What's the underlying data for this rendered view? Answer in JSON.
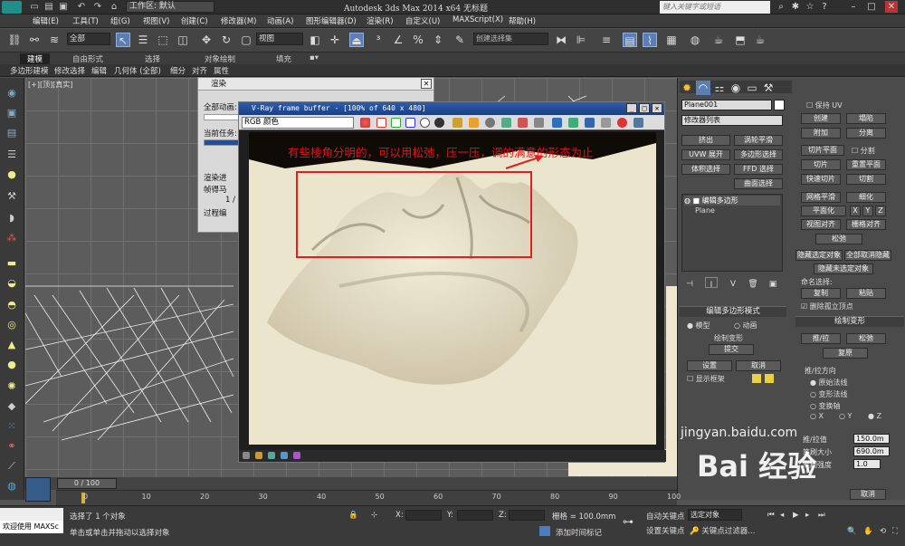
{
  "titlebar": {
    "workspace_label": "工作区: 默认",
    "app_title": "Autodesk 3ds Max  2014 x64       无标题",
    "search_placeholder": "键入关键字或短语"
  },
  "menu": [
    "编辑(E)",
    "工具(T)",
    "组(G)",
    "视图(V)",
    "创建(C)",
    "修改器(M)",
    "动画(A)",
    "图形编辑器(D)",
    "渲染(R)",
    "自定义(U)",
    "MAXScript(X)",
    "帮助(H)"
  ],
  "toolbar": {
    "selection_filter": "全部",
    "ref_coord": "视图",
    "named_selection": "创建选择集"
  },
  "ribbon": {
    "tabs": [
      "建模",
      "自由形式",
      "选择",
      "对象绘制",
      "填充"
    ],
    "subtabs": [
      "多边形建模",
      "修改选择",
      "编辑",
      "几何体 (全部)",
      "细分",
      "对齐",
      "属性"
    ]
  },
  "viewport": {
    "label": "[+][顶][真实]"
  },
  "render_dialog": {
    "title": "渲染",
    "all_anim": "全部动画:",
    "current_task": "当前任务:",
    "rows": [
      "渲染进",
      "帧得马",
      "1 /",
      "过程编"
    ]
  },
  "vfb": {
    "title": "V-Ray frame buffer - [100% of 640 x 480]",
    "channel": "RGB 颜色"
  },
  "annotation": "有些棱角分明的，可以用松弛，压一压，调的满意的形态为止",
  "command_panel": {
    "object_name": "Plane001",
    "modifier_list": "修改器列表",
    "buttons_left": [
      {
        "a": "挤出",
        "b": "涡轮平滑"
      },
      {
        "a": "UVW 展开",
        "b": "多边形选择"
      },
      {
        "a": "体积选择",
        "b": "FFD 选择"
      },
      {
        "a": "",
        "b": "曲面选择"
      }
    ],
    "stack": [
      "编辑多边形",
      "Plane"
    ],
    "paint_deform": {
      "header": "编辑多边形模式",
      "model": "模型",
      "anim": "动画",
      "label": "绘制变形",
      "commit": "提交",
      "settings": "设置",
      "cancel": "取消",
      "show_cage": "显示框架"
    },
    "right_col": {
      "keep_uv": "保持 UV",
      "create": "创建",
      "collapse": "塌陷",
      "attach": "附加",
      "detach": "分离",
      "slice_plane": "切片平面",
      "split": "分割",
      "slice": "切片",
      "reset_plane": "重置平面",
      "quickslice": "快速切片",
      "cut": "切割",
      "meshsmooth": "网格平滑",
      "tessellate": "细化",
      "planarize": "平面化",
      "x": "X",
      "y": "Y",
      "z": "Z",
      "view_align": "视图对齐",
      "grid_align": "栅格对齐",
      "relax": "松弛",
      "hide_sel": "隐藏选定对象",
      "unhide_all": "全部取消隐藏",
      "hide_unsel": "隐藏未选定对象",
      "named_sel": "命名选择:",
      "copy": "复制",
      "paste": "粘贴",
      "delete_iso": "删除孤立顶点",
      "paint_deform_hdr": "绘制变形",
      "push_pull": "推/拉",
      "relax2": "松弛",
      "revert": "复原",
      "pp_dir": "推/拉方向",
      "orig_normals": "原始法线",
      "deformed_normals": "变形法线",
      "transform_axis": "变换轴",
      "ax": "X",
      "ay": "Y",
      "az": "Z",
      "pp_value": "推/拉值",
      "pp_val_num": "150.0m",
      "brush_size": "笔刷大小",
      "brush_size_num": "690.0m",
      "brush_strength": "笔刷强度",
      "brush_strength_num": "1.0",
      "cancel": "取消"
    }
  },
  "timeline": {
    "frame": "0 / 100",
    "ticks": [
      "0",
      "10",
      "20",
      "30",
      "40",
      "50",
      "60",
      "70",
      "80",
      "90",
      "100"
    ]
  },
  "status": {
    "selected": "选择了 1 个对象",
    "hint": "单击或单击并拖动以选择对象",
    "maxscript": "欢迎使用 MAXSc",
    "x_label": "X:",
    "y_label": "Y:",
    "z_label": "Z:",
    "grid": "栅格 = 100.0mm",
    "auto_key": "自动关键点",
    "set_key": "设置关键点",
    "sel_obj": "选定对象",
    "add_time": "添加时间标记",
    "key_filter": "关键点过滤器..."
  },
  "watermark": {
    "logo": "Bai 经验",
    "url": "jingyan.baidu.com"
  }
}
